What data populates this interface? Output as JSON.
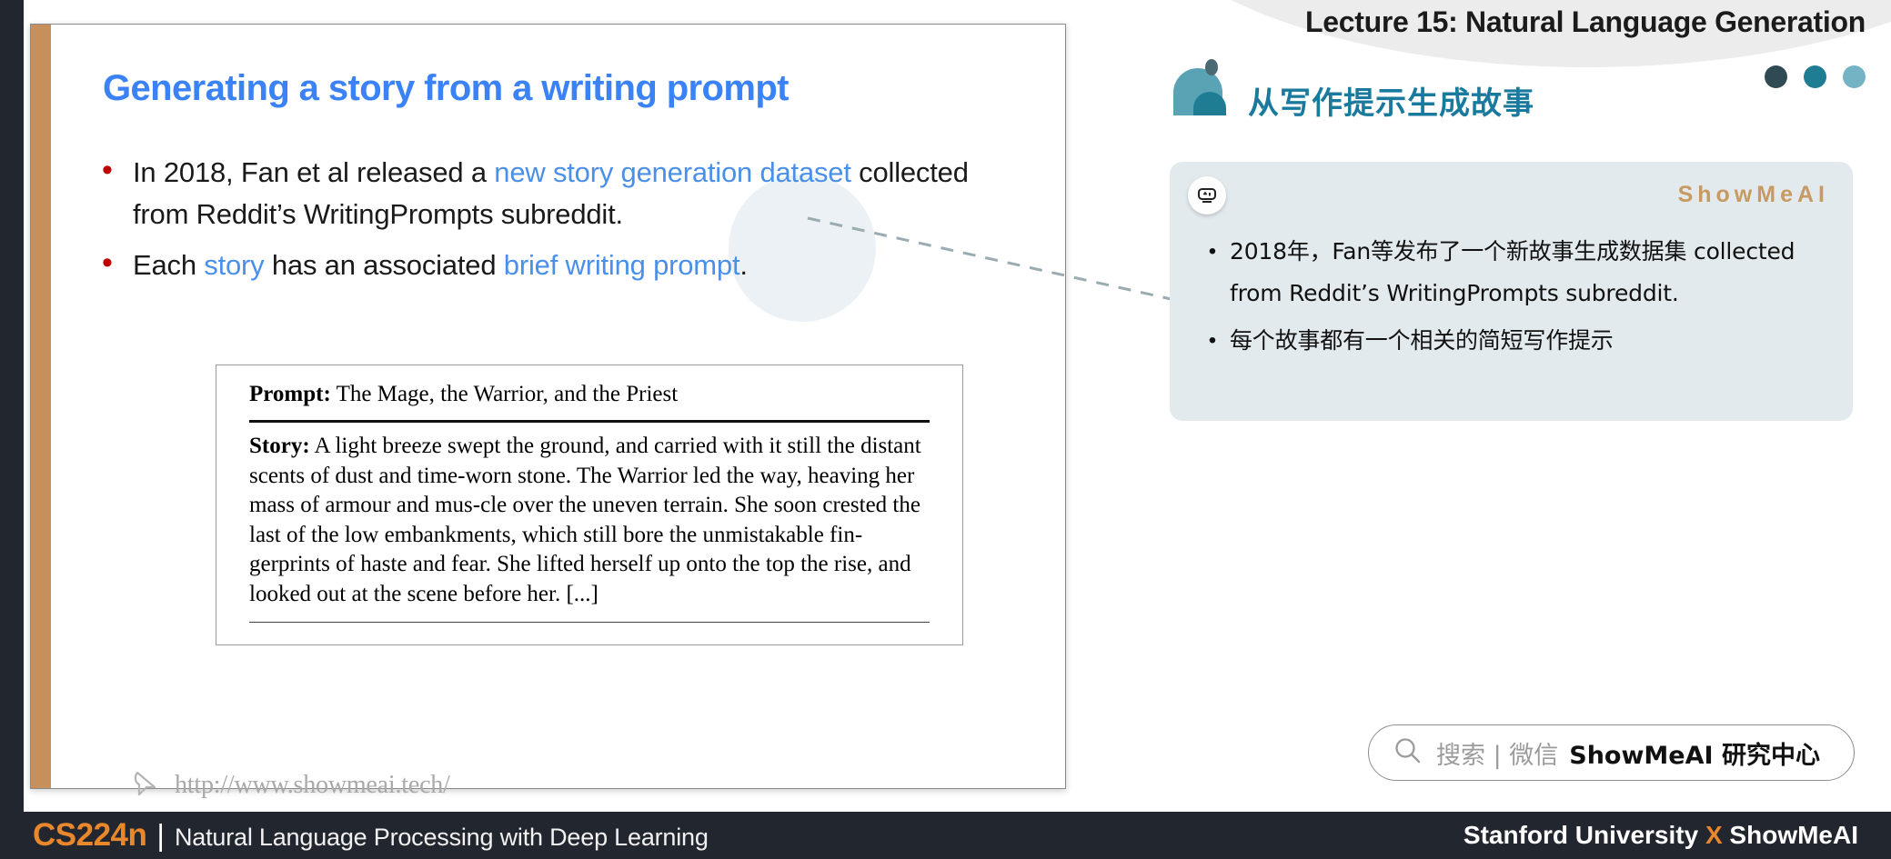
{
  "header": {
    "lecture_title": "Lecture 15: Natural Language Generation",
    "cn_title": "从写作提示生成故事",
    "dots": [
      "dot-dark",
      "dot-mid",
      "dot-light"
    ]
  },
  "slide": {
    "title": "Generating a story from a writing prompt",
    "bullets": [
      {
        "segments": [
          {
            "text": "In 2018, Fan et al released a ",
            "highlight": false
          },
          {
            "text": "new story generation dataset",
            "highlight": true
          },
          {
            "text": " collected from Reddit’s WritingPrompts subreddit.",
            "highlight": false
          }
        ]
      },
      {
        "segments": [
          {
            "text": "Each ",
            "highlight": false
          },
          {
            "text": "story",
            "highlight": true
          },
          {
            "text": " has an associated ",
            "highlight": false
          },
          {
            "text": "brief writing prompt",
            "highlight": true
          },
          {
            "text": ".",
            "highlight": false
          }
        ]
      }
    ],
    "excerpt": {
      "prompt_label": "Prompt:",
      "prompt_text": " The Mage, the Warrior, and the Priest",
      "story_label": "Story:",
      "story_text": "  A light breeze swept the ground, and carried with it still the distant scents of dust and time-worn stone. The Warrior led the way, heaving her mass of armour and mus-cle over the uneven terrain. She soon crested the last of the low embankments, which still bore the unmistakable fin-gerprints of haste and fear.  She lifted herself up onto the top the rise, and looked out at the scene before her. [...]"
    },
    "watermark_url": "http://www.showmeai.tech/"
  },
  "note": {
    "brand": "ShowMeAI",
    "items": [
      "2018年，Fan等发布了一个新故事生成数据集 collected from Reddit’s WritingPrompts subreddit.",
      "每个故事都有一个相关的简短写作提示"
    ]
  },
  "search": {
    "placeholder": "搜索 | 微信",
    "brand": "ShowMeAI 研究中心"
  },
  "footer": {
    "course_code": "CS224n",
    "divider": "|",
    "course_name": "Natural Language Processing with Deep Learning",
    "right_pre": "Stanford University ",
    "right_x": "X",
    "right_post": " ShowMeAI"
  },
  "colors": {
    "accent_blue": "#3b82f6",
    "link_blue": "#4a90e8",
    "bullet_red": "#c00000",
    "slide_accent": "#c78f5b",
    "teal": "#1a7a9e",
    "orange": "#e8872b",
    "footer_bg": "#22262f",
    "note_bg": "#e3eaed",
    "brand_gold": "#c79a62"
  }
}
